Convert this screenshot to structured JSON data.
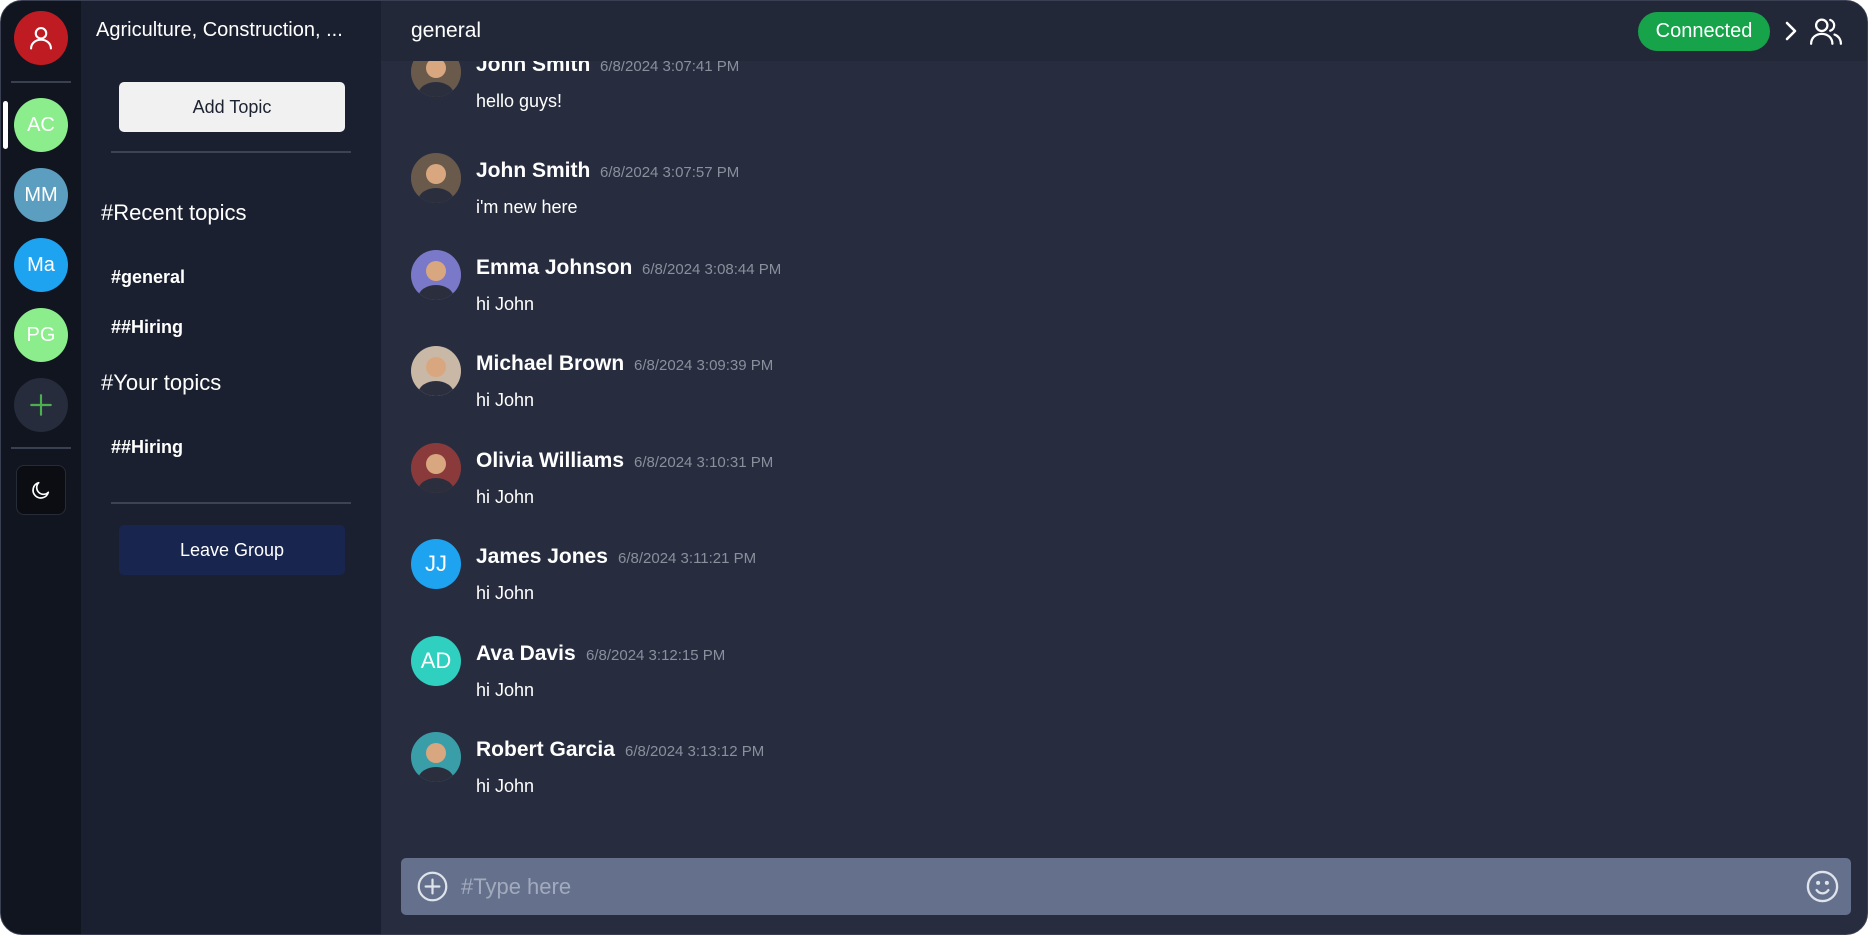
{
  "colors": {
    "rail_bg": "#111520",
    "sidebar_bg": "#1b2030",
    "chat_bg": "#272d3f",
    "header_bg": "#222838",
    "accent_green": "#16a34a",
    "leave_button": "#18254f",
    "composer_bg": "#65718c",
    "profile_red": "#bf1b22"
  },
  "rail": {
    "profile_icon": "user-icon",
    "servers": [
      {
        "initials": "AC",
        "color": "#8bed8b"
      },
      {
        "initials": "MM",
        "color": "#5c9ec0"
      },
      {
        "initials": "Ma",
        "color": "#1ea3f1"
      },
      {
        "initials": "PG",
        "color": "#8bed8b"
      }
    ],
    "add_icon": "plus-icon",
    "theme_icon": "moon-icon"
  },
  "sidebar": {
    "group_name": "Agriculture, Construction, ...",
    "add_topic_label": "Add Topic",
    "recent_title": "#Recent topics",
    "recent_topics": [
      "#general",
      "##Hiring"
    ],
    "your_title": "#Your topics",
    "your_topics": [
      "##Hiring"
    ],
    "leave_label": "Leave Group"
  },
  "header": {
    "channel": "general",
    "status": "Connected",
    "chevron_icon": "chevron-right-icon",
    "members_icon": "users-icon"
  },
  "messages": [
    {
      "author": "John Smith",
      "time": "6/8/2024 3:07:41 PM",
      "text": "hello guys!",
      "avatar_type": "photo",
      "avatar_color": "#6a5a4c"
    },
    {
      "author": "John Smith",
      "time": "6/8/2024 3:07:57 PM",
      "text": "i'm new here",
      "avatar_type": "photo",
      "avatar_color": "#6a5a4c"
    },
    {
      "author": "Emma Johnson",
      "time": "6/8/2024 3:08:44 PM",
      "text": "hi John",
      "avatar_type": "photo",
      "avatar_color": "#7a78c8"
    },
    {
      "author": "Michael Brown",
      "time": "6/8/2024 3:09:39 PM",
      "text": "hi John",
      "avatar_type": "photo",
      "avatar_color": "#c9b8a6"
    },
    {
      "author": "Olivia Williams",
      "time": "6/8/2024 3:10:31 PM",
      "text": "hi John",
      "avatar_type": "photo",
      "avatar_color": "#8a3a3a"
    },
    {
      "author": "James Jones",
      "time": "6/8/2024 3:11:21 PM",
      "text": "hi John",
      "avatar_type": "initials",
      "initials": "JJ",
      "avatar_color": "#1ea3f1"
    },
    {
      "author": "Ava Davis",
      "time": "6/8/2024 3:12:15 PM",
      "text": "hi John",
      "avatar_type": "initials",
      "initials": "AD",
      "avatar_color": "#2fd0c0"
    },
    {
      "author": "Robert Garcia",
      "time": "6/8/2024 3:13:12 PM",
      "text": "hi John",
      "avatar_type": "photo",
      "avatar_color": "#3a9ea8"
    }
  ],
  "composer": {
    "plus_icon": "plus-circle-icon",
    "placeholder": "#Type here",
    "value": "",
    "emoji_icon": "smiley-icon"
  }
}
